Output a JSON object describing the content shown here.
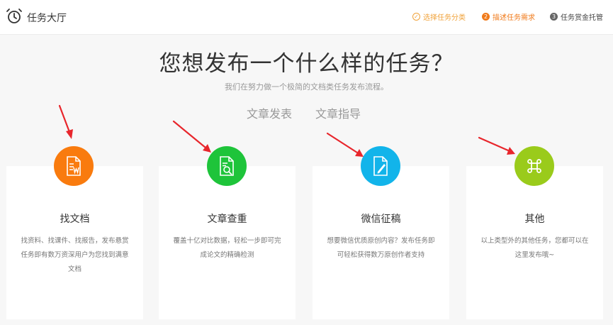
{
  "header": {
    "app_title": "任务大厅",
    "steps": [
      {
        "number": "✓",
        "label": "选择任务分类",
        "state": "done"
      },
      {
        "number": "2",
        "label": "描述任务需求",
        "state": "active"
      },
      {
        "number": "3",
        "label": "任务赏金托管",
        "state": "todo"
      }
    ]
  },
  "main": {
    "title": "您想发布一个什么样的任务？",
    "subtitle": "我们在努力做一个极简的文档类任务发布流程。",
    "links": [
      "文章发表",
      "文章指导"
    ]
  },
  "cards": [
    {
      "name": "找文档",
      "desc": "找资料、找课件、找报告，发布悬赏任务即有数万资深用户为您找到满意文档",
      "color": "#f97b0e",
      "icon": "document-w-icon"
    },
    {
      "name": "文章查重",
      "desc": "覆盖十亿对比数据，轻松一步即可完成论文的精确检测",
      "color": "#1ec43a",
      "icon": "document-search-icon"
    },
    {
      "name": "微信征稿",
      "desc": "想要微信优质原创内容？发布任务即可轻松获得数万原创作者支持",
      "color": "#12b4ea",
      "icon": "document-edit-icon"
    },
    {
      "name": "其他",
      "desc": "以上类型外的其他任务，您都可以在这里发布哦~",
      "color": "#9acb1b",
      "icon": "command-icon"
    }
  ],
  "colors": {
    "accent": "#f07a1a",
    "arrow": "#e8262c"
  }
}
